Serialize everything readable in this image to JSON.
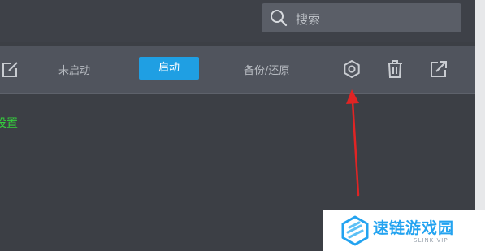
{
  "search": {
    "placeholder": "搜索",
    "icon": "search-icon"
  },
  "toolbar": {
    "edit_icon": "edit-icon",
    "not_started_label": "未启动",
    "start_label": "启动",
    "backup_restore_label": "备份/还原",
    "settings_icon": "gear-icon",
    "delete_icon": "trash-icon",
    "share_icon": "share-icon"
  },
  "content": {
    "settings_link": "设置"
  },
  "watermark": {
    "title": "速链游戏园",
    "subtitle": "SLINK.VIP"
  },
  "colors": {
    "start_button": "#1f9fe3",
    "link_green": "#34d13c",
    "arrow_red": "#e02424",
    "watermark_blue": "#23a3f0"
  }
}
